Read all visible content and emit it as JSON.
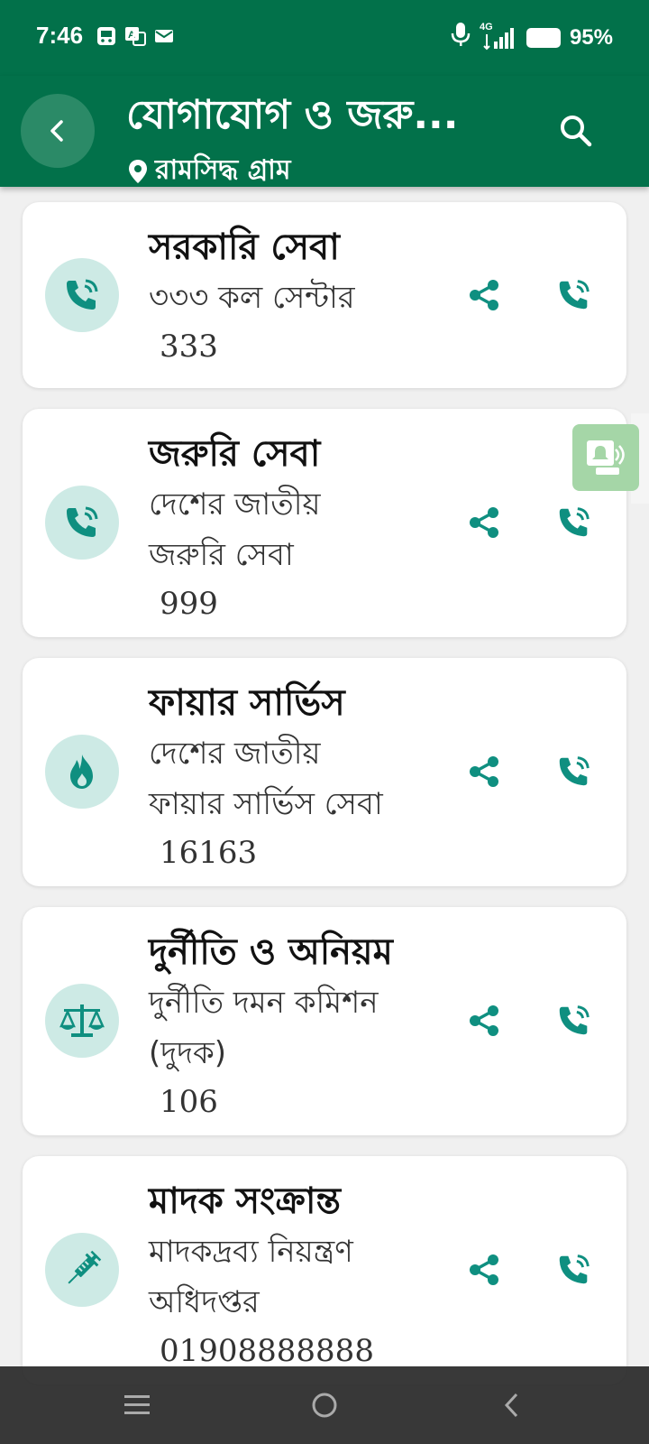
{
  "status_bar": {
    "time": "7:46",
    "network": "4G",
    "battery_percent": "95%",
    "left_icons": [
      "bus-icon",
      "translate-icon",
      "mail-icon"
    ],
    "right_icons": [
      "mic-icon",
      "signal-icon",
      "battery-icon"
    ]
  },
  "app_bar": {
    "title": "যোগাযোগ ও জরু...",
    "location": "রামসিদ্ধ গ্রাম",
    "background": "#02714a"
  },
  "accent_color": "#0f8f80",
  "contacts": [
    {
      "title": "সরকারি সেবা",
      "lines": [
        "৩৩৩ কল সেন্টার"
      ],
      "number": "333",
      "icon": "phone-ring-icon"
    },
    {
      "title": "জরুরি সেবা",
      "lines": [
        "দেশের জাতীয়",
        "জরুরি সেবা"
      ],
      "number": "999",
      "icon": "phone-ring-icon"
    },
    {
      "title": "ফায়ার সার্ভিস",
      "lines": [
        "দেশের জাতীয়",
        "ফায়ার সার্ভিস সেবা"
      ],
      "number": "16163",
      "icon": "fire-icon"
    },
    {
      "title": "দুর্নীতি ও অনিয়ম",
      "lines": [
        "দুর্নীতি দমন কমিশন",
        "(দুদক)"
      ],
      "number": "106",
      "icon": "scale-icon"
    },
    {
      "title": "মাদক সংক্রান্ত",
      "lines": [
        "মাদকদ্রব্য নিয়ন্ত্রণ",
        "অধিদপ্তর"
      ],
      "number": "01908888888",
      "icon": "syringe-icon"
    }
  ],
  "navigation_bar": {
    "buttons": [
      "menu-icon",
      "home-icon",
      "back-icon"
    ]
  }
}
